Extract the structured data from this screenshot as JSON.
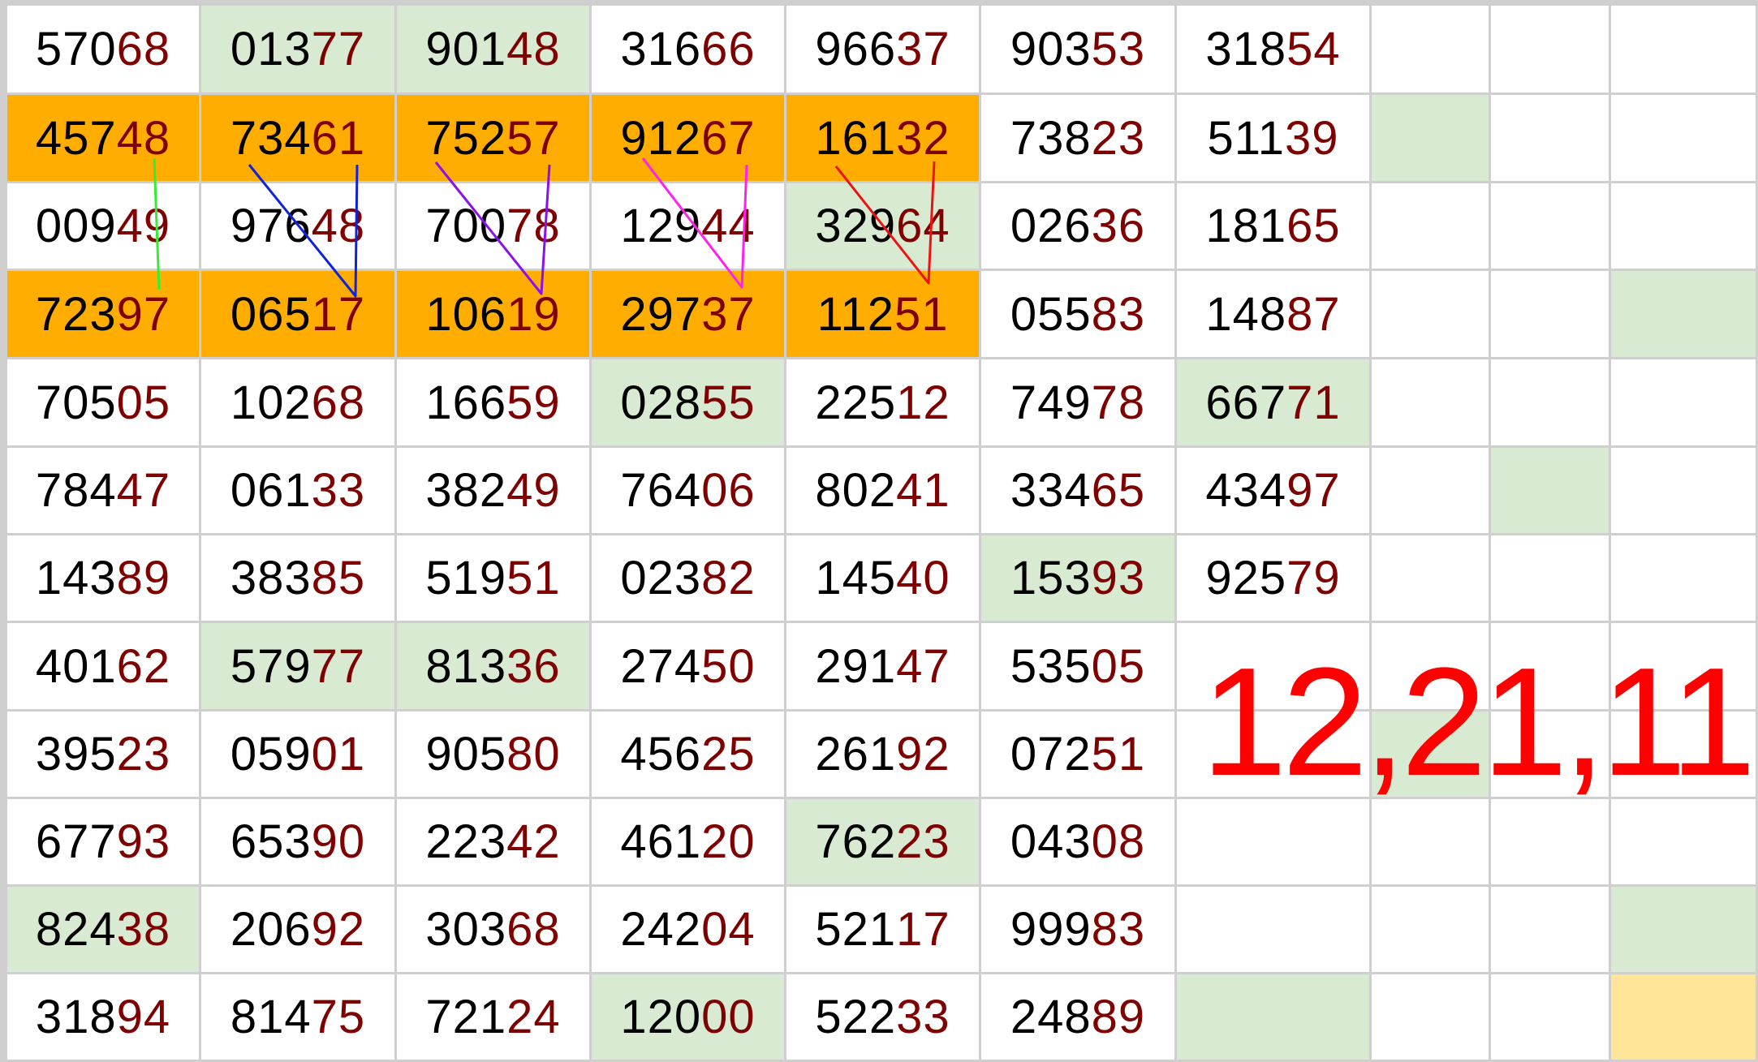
{
  "sheet": {
    "columns": 10,
    "digit_color_head": "#000000",
    "digit_color_tail": "#7f0000",
    "fill_colors": {
      "green": "#d9ead3",
      "orange": "#ffad00",
      "yellow": "#ffe599"
    },
    "rows": [
      [
        {
          "head": "570",
          "tail": "68"
        },
        {
          "head": "013",
          "tail": "77",
          "fill": "green"
        },
        {
          "head": "901",
          "tail": "48",
          "fill": "green"
        },
        {
          "head": "316",
          "tail": "66"
        },
        {
          "head": "966",
          "tail": "37"
        },
        {
          "head": "903",
          "tail": "53"
        },
        {
          "head": "318",
          "tail": "54"
        },
        {},
        {},
        {}
      ],
      [
        {
          "head": "457",
          "tail": "48",
          "fill": "orange"
        },
        {
          "head": "734",
          "tail": "61",
          "fill": "orange"
        },
        {
          "head": "752",
          "tail": "57",
          "fill": "orange"
        },
        {
          "head": "912",
          "tail": "67",
          "fill": "orange"
        },
        {
          "head": "161",
          "tail": "32",
          "fill": "orange"
        },
        {
          "head": "738",
          "tail": "23"
        },
        {
          "head": "511",
          "tail": "39"
        },
        {
          "fill": "green"
        },
        {},
        {}
      ],
      [
        {
          "head": "009",
          "tail": "49"
        },
        {
          "head": "976",
          "tail": "48"
        },
        {
          "head": "700",
          "tail": "78"
        },
        {
          "head": "129",
          "tail": "44"
        },
        {
          "head": "329",
          "tail": "64",
          "fill": "green"
        },
        {
          "head": "026",
          "tail": "36"
        },
        {
          "head": "181",
          "tail": "65"
        },
        {},
        {},
        {}
      ],
      [
        {
          "head": "723",
          "tail": "97",
          "fill": "orange"
        },
        {
          "head": "065",
          "tail": "17",
          "fill": "orange"
        },
        {
          "head": "106",
          "tail": "19",
          "fill": "orange"
        },
        {
          "head": "297",
          "tail": "37",
          "fill": "orange"
        },
        {
          "head": "112",
          "tail": "51",
          "fill": "orange"
        },
        {
          "head": "055",
          "tail": "83"
        },
        {
          "head": "148",
          "tail": "87"
        },
        {},
        {},
        {
          "fill": "green"
        }
      ],
      [
        {
          "head": "705",
          "tail": "05"
        },
        {
          "head": "102",
          "tail": "68"
        },
        {
          "head": "166",
          "tail": "59"
        },
        {
          "head": "028",
          "tail": "55",
          "fill": "green"
        },
        {
          "head": "225",
          "tail": "12"
        },
        {
          "head": "749",
          "tail": "78"
        },
        {
          "head": "667",
          "tail": "71",
          "fill": "green"
        },
        {},
        {},
        {}
      ],
      [
        {
          "head": "784",
          "tail": "47"
        },
        {
          "head": "061",
          "tail": "33"
        },
        {
          "head": "382",
          "tail": "49"
        },
        {
          "head": "764",
          "tail": "06"
        },
        {
          "head": "802",
          "tail": "41"
        },
        {
          "head": "334",
          "tail": "65"
        },
        {
          "head": "434",
          "tail": "97"
        },
        {},
        {
          "fill": "green"
        },
        {}
      ],
      [
        {
          "head": "143",
          "tail": "89"
        },
        {
          "head": "383",
          "tail": "85"
        },
        {
          "head": "519",
          "tail": "51"
        },
        {
          "head": "023",
          "tail": "82"
        },
        {
          "head": "145",
          "tail": "40"
        },
        {
          "head": "153",
          "tail": "93",
          "fill": "green"
        },
        {
          "head": "925",
          "tail": "79"
        },
        {},
        {},
        {}
      ],
      [
        {
          "head": "401",
          "tail": "62"
        },
        {
          "head": "579",
          "tail": "77",
          "fill": "green"
        },
        {
          "head": "813",
          "tail": "36",
          "fill": "green"
        },
        {
          "head": "274",
          "tail": "50"
        },
        {
          "head": "291",
          "tail": "47"
        },
        {
          "head": "535",
          "tail": "05"
        },
        {},
        {},
        {},
        {}
      ],
      [
        {
          "head": "395",
          "tail": "23"
        },
        {
          "head": "059",
          "tail": "01"
        },
        {
          "head": "905",
          "tail": "80"
        },
        {
          "head": "456",
          "tail": "25"
        },
        {
          "head": "261",
          "tail": "92"
        },
        {
          "head": "072",
          "tail": "51"
        },
        {},
        {
          "fill": "green"
        },
        {},
        {}
      ],
      [
        {
          "head": "677",
          "tail": "93"
        },
        {
          "head": "653",
          "tail": "90"
        },
        {
          "head": "223",
          "tail": "42"
        },
        {
          "head": "461",
          "tail": "20"
        },
        {
          "head": "762",
          "tail": "23",
          "fill": "green"
        },
        {
          "head": "043",
          "tail": "08"
        },
        {},
        {},
        {},
        {}
      ],
      [
        {
          "head": "824",
          "tail": "38",
          "fill": "green"
        },
        {
          "head": "206",
          "tail": "92"
        },
        {
          "head": "303",
          "tail": "68"
        },
        {
          "head": "242",
          "tail": "04"
        },
        {
          "head": "521",
          "tail": "17"
        },
        {
          "head": "999",
          "tail": "83"
        },
        {},
        {},
        {},
        {
          "fill": "green"
        }
      ],
      [
        {
          "head": "318",
          "tail": "94"
        },
        {
          "head": "814",
          "tail": "75"
        },
        {
          "head": "721",
          "tail": "24"
        },
        {
          "head": "120",
          "tail": "00",
          "fill": "green"
        },
        {
          "head": "522",
          "tail": "33"
        },
        {
          "head": "248",
          "tail": "89"
        },
        {
          "fill": "green"
        },
        {},
        {},
        {
          "fill": "yellow"
        }
      ]
    ]
  },
  "annotation": {
    "text": "12,21,11",
    "color": "#ff0000",
    "line_colors": [
      "#33ee33",
      "#1122dd",
      "#8811ee",
      "#ff22ee",
      "#ee1111"
    ]
  }
}
